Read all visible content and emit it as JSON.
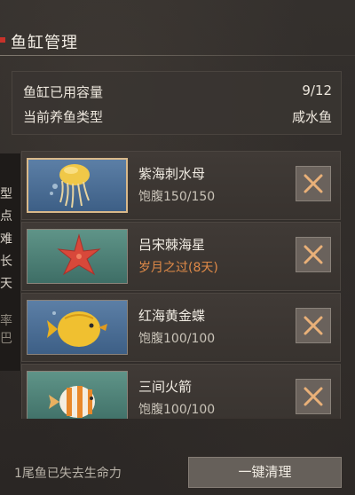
{
  "header": {
    "title": "鱼缸管理"
  },
  "info": {
    "capacity_label": "鱼缸已用容量",
    "capacity_value": "9/12",
    "type_label": "当前养鱼类型",
    "type_value": "咸水鱼"
  },
  "side_panel": {
    "chars": [
      "型",
      "点",
      "难",
      "长",
      "天",
      "",
      "率",
      "巴"
    ]
  },
  "fish_list": [
    {
      "name": "紫海刺水母",
      "status": "饱腹150/150",
      "status_kind": "normal",
      "icon": "jellyfish-icon",
      "selected": true
    },
    {
      "name": "吕宋棘海星",
      "status": "岁月之过(8天)",
      "status_kind": "warning",
      "icon": "starfish-icon",
      "selected": false
    },
    {
      "name": "红海黄金蝶",
      "status": "饱腹100/100",
      "status_kind": "normal",
      "icon": "butterflyfish-icon",
      "selected": false
    },
    {
      "name": "三间火箭",
      "status": "饱腹100/100",
      "status_kind": "normal",
      "icon": "clownfish-icon",
      "selected": false
    }
  ],
  "footer": {
    "status_text": "1尾鱼已失去生命力",
    "clean_button_label": "一键清理"
  },
  "colors": {
    "accent_red": "#c8322a",
    "warning_orange": "#e08a48",
    "selected_border": "#d9b98a"
  }
}
